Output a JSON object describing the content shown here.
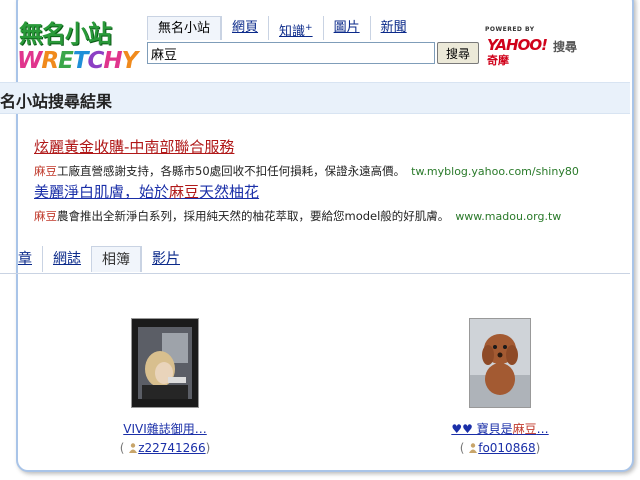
{
  "logo": {
    "top_text": "無名小站",
    "bottom_letters": [
      "W",
      "R",
      "E",
      "T",
      "C",
      "H",
      "Y"
    ]
  },
  "search": {
    "tabs": [
      "無名小站",
      "網頁",
      "知識",
      "圖片",
      "新聞"
    ],
    "tab_sup": "+",
    "query": "麻豆",
    "button_label": "搜尋"
  },
  "yahoo": {
    "powered": "POWERED BY",
    "logo": "YAHOO!",
    "sub": "奇摩",
    "sou": "搜尋"
  },
  "results_title": "名小站搜尋結果",
  "sponsored": [
    {
      "title": "炫麗黃金收購-中南部聯合服務",
      "desc_highlight": "麻豆",
      "desc_rest": "工廠直營感謝支持，各縣市50處回收不扣任何損耗，保證永遠高價。",
      "url": "tw.myblog.yahoo.com/shiny80"
    },
    {
      "title_pre": "美麗淨白肌膚，始於",
      "title_highlight": "麻豆",
      "title_post": "天然柚花",
      "desc_highlight": "麻豆",
      "desc_rest": "農會推出全新淨白系列，採用純天然的柚花萃取，要給您model般的好肌膚。",
      "url": "www.madou.org.tw"
    }
  ],
  "category_tabs": [
    "章",
    "網誌",
    "相簿",
    "影片"
  ],
  "active_category": "相簿",
  "photos": [
    {
      "caption": "VIVI雜誌御用…",
      "owner": "z22741266"
    },
    {
      "caption_pre": "♥♥ 寶貝是",
      "caption_highlight": "麻豆",
      "caption_post": "…",
      "owner": "fo010868"
    }
  ],
  "colors": {
    "accent_red": "#b01818",
    "link_blue": "#1a2fa8",
    "url_green": "#2a7a2a",
    "bar_bg": "#e9f1fa"
  }
}
